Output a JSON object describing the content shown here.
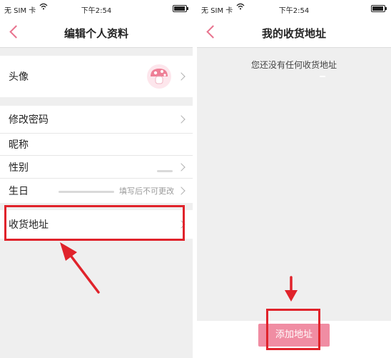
{
  "left": {
    "status": {
      "carrier": "无 SIM 卡",
      "time": "下午2:54"
    },
    "nav": {
      "title": "编辑个人资料"
    },
    "rows": {
      "avatar_label": "头像",
      "password_label": "修改密码",
      "nickname_label": "昵称",
      "gender_label": "性别",
      "birthday_label": "生日",
      "birthday_hint": "填写后不可更改",
      "address_label": "收货地址"
    }
  },
  "right": {
    "status": {
      "carrier": "无 SIM 卡",
      "time": "下午2:54"
    },
    "nav": {
      "title": "我的收货地址"
    },
    "empty_text": "您还没有任何收货地址",
    "add_button": "添加地址"
  },
  "colors": {
    "accent": "#f08da3",
    "back_arrow": "#e8738e",
    "annotation": "#e0232b"
  }
}
